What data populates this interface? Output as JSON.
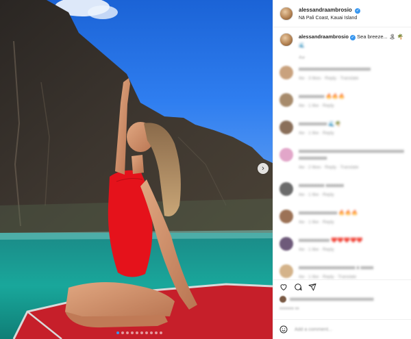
{
  "post": {
    "username": "alessandraambrosio",
    "location": "Nā Pali Coast, Kauai Island",
    "caption_username": "alessandraambrosio",
    "caption_text": "Sea breeze... 🏝 🌴",
    "caption_sub": "🌊",
    "caption_time": "4w",
    "carousel_count": 10,
    "carousel_active": 0
  },
  "comments": [
    {
      "text": "xxxxxxxxxxxxxxxxxxxxxxxxxxxx",
      "meta": "4w · 3 likes · Reply · Translate",
      "avatar_color": "#c9a27e"
    },
    {
      "text": "xxxxxxxxxx 🔥🔥🔥",
      "meta": "4w · 1 like · Reply",
      "avatar_color": "#a78b6c"
    },
    {
      "text": "xxxxxxxxxxx 🌊🌴",
      "meta": "4w · 1 like · Reply",
      "avatar_color": "#8a6f5a"
    },
    {
      "text": "xxxxxxxxxxxxxxxxxxxxxxxxxxxxxxxxxxxxxxxxxxxxxxxxxxxx",
      "meta": "4w · 2 likes · Reply · Translate",
      "avatar_color": "#e2a6c9"
    },
    {
      "text": "xxxxxxxxxx xxxxxxx",
      "meta": "4w · 1 like · Reply",
      "avatar_color": "#6b6b6b"
    },
    {
      "text": "xxxxxxxxxxxxxxx 🔥🔥🔥",
      "meta": "4w · 1 like · Reply",
      "avatar_color": "#9c7256"
    },
    {
      "text": "xxxxxxxxxxxx ❤️❤️❤️❤️❤️",
      "meta": "4w · 1 like · Reply",
      "avatar_color": "#6e5a7a"
    },
    {
      "text": "xxxxxxxxxxxxxxxxxxxxxx x xxxxx",
      "meta": "4w · 1 like · Reply · Translate",
      "avatar_color": "#d4b38a"
    }
  ],
  "likes": {
    "text": "xxxxxxxxxxxxxxxxxxxxxxxxxxxxxxxxxxx"
  },
  "post_date": "xxxxxxx xx",
  "add_comment": {
    "placeholder": "Add a comment..."
  },
  "icons": [
    "heart-icon",
    "comment-icon",
    "share-icon",
    "next-arrow-icon",
    "emoji-icon",
    "verified-badge-icon"
  ],
  "colors": {
    "accent": "#3897f0",
    "border": "#efefef",
    "muted": "#999999"
  }
}
